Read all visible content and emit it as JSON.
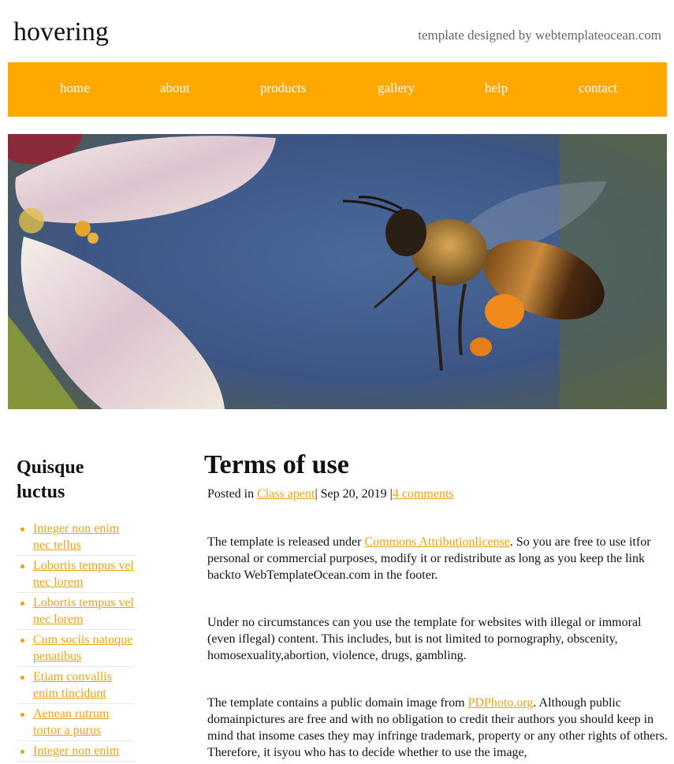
{
  "header": {
    "logo": "hovering",
    "credit": "template designed by webtemplateocean.com"
  },
  "nav": {
    "items": [
      "home",
      "about",
      "products",
      "gallery",
      "help",
      "contact"
    ]
  },
  "hero": {
    "image": "bee-flower-photo"
  },
  "sidebar": {
    "title": "Quisque luctus",
    "links": [
      "Integer non enim nec tellus",
      "Lobortis tempus vel nec lorem",
      "Lobortis tempus vel nec lorem",
      "Cum sociis natoque penatibus",
      "Etiam convallis enim tincidunt",
      "Aenean rutrum tortor a purus",
      "Integer non enim"
    ]
  },
  "post": {
    "title": "Terms of use",
    "posted_in": "Posted in",
    "category": "Class apent",
    "date": "| Sep 20, 2019 |",
    "comments": "4 comments",
    "p1_before": "The template is released under ",
    "p1_link": "Commons Attributionlicense",
    "p1_after": ". So you are free to use itfor personal or commercial purposes, modify it or redistribute as long as you keep the link backto WebTemplateOcean.com in the footer.",
    "p2": "Under no circumstances can you use the template for websites with illegal or immoral (even iflegal) content. This includes, but is not limited to pornography, obscenity, homosexuality,abortion, violence, drugs, gambling.",
    "p3_before": "The template contains a public domain image from ",
    "p3_link": "PDPhoto.org",
    "p3_after": ". Although public domainpictures are free and with no obligation to credit their authors you should keep in mind that insome cases they may infringe trademark, property or any other rights of others. Therefore, it isyou who has to decide whether to use the image,"
  },
  "colors": {
    "accent": "#ffa800",
    "link": "#e8a317"
  }
}
